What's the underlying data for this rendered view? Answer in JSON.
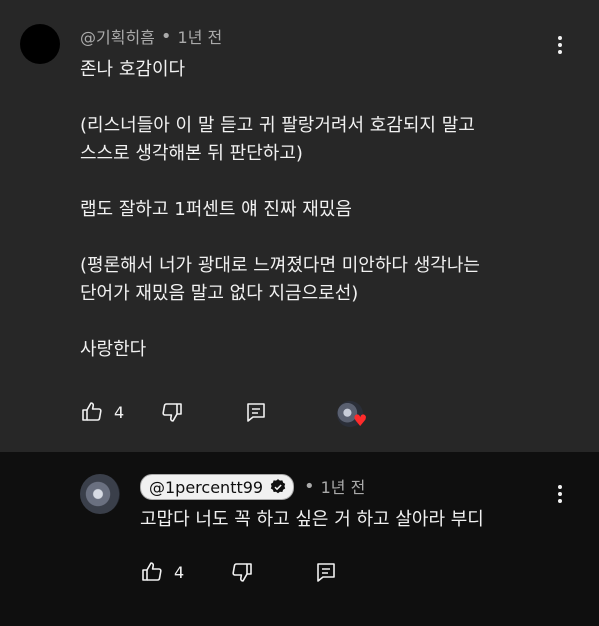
{
  "comment": {
    "author": "@기획히흠",
    "time": "1년 전",
    "lines": [
      "존나 호감이다",
      "",
      "(리스너들아 이 말 듣고 귀 팔랑거려서 호감되지 말고",
      "스스로 생각해본 뒤 판단하고)",
      "",
      "랩도 잘하고 1퍼센트 얘 진짜 재밌음",
      "",
      "(평론해서 너가 광대로 느껴졌다면 미안하다 생각나는",
      "단어가 재밌음 말고 없다 지금으로선)",
      "",
      "사랑한다"
    ],
    "like_count": "4",
    "creator_hearted": true
  },
  "reply": {
    "author": "@1percentt99",
    "time": "1년 전",
    "text": "고맙다 너도 꼭 하고 싶은 거 하고 살아라 부디",
    "like_count": "4"
  },
  "icons": {
    "like": "thumbs-up-icon",
    "dislike": "thumbs-down-icon",
    "reply": "reply-icon",
    "more": "more-vert-icon",
    "verified": "verified-check-icon",
    "heart": "heart-icon"
  },
  "colors": {
    "top_bg": "#272727",
    "bottom_bg": "#0f0f0f",
    "text": "#f1f1f1",
    "secondary": "#aaaaaa",
    "heart": "#ff2b2b"
  }
}
